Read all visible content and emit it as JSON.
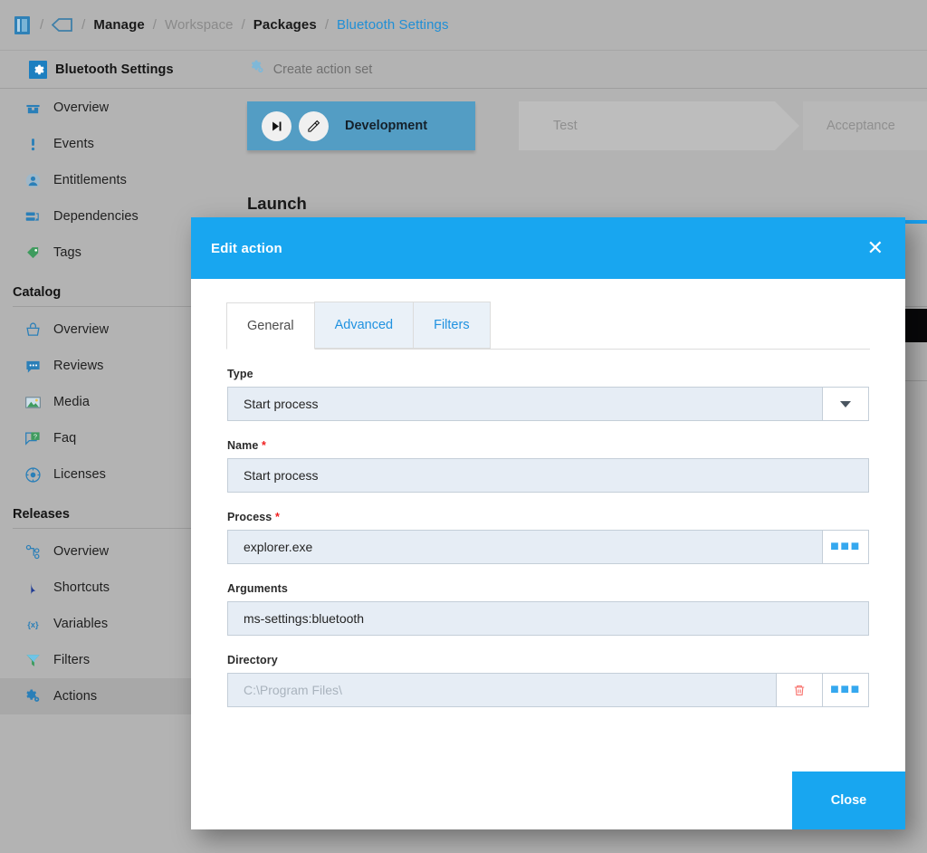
{
  "breadcrumb": {
    "library_icon": "book-icon",
    "tag_icon": "tag-icon",
    "separator": "/",
    "items": [
      {
        "label": "Manage",
        "style": "dark"
      },
      {
        "label": "Workspace",
        "style": "mute"
      },
      {
        "label": "Packages",
        "style": "dark"
      },
      {
        "label": "Bluetooth Settings",
        "style": "blue"
      }
    ]
  },
  "appbar": {
    "icon": "gear-icon",
    "title": "Bluetooth Settings",
    "action_icon": "action-set-icon",
    "action_label": "Create action set"
  },
  "sidebar": {
    "top_items": [
      {
        "label": "Overview",
        "icon": "package-icon"
      },
      {
        "label": "Events",
        "icon": "exclamation-icon"
      },
      {
        "label": "Entitlements",
        "icon": "user-icon"
      },
      {
        "label": "Dependencies",
        "icon": "dependencies-icon"
      },
      {
        "label": "Tags",
        "icon": "tag-icon"
      }
    ],
    "groups": [
      {
        "title": "Catalog",
        "items": [
          {
            "label": "Overview",
            "icon": "basket-icon"
          },
          {
            "label": "Reviews",
            "icon": "comment-icon"
          },
          {
            "label": "Media",
            "icon": "image-icon"
          },
          {
            "label": "Faq",
            "icon": "faq-icon"
          },
          {
            "label": "Licenses",
            "icon": "license-icon"
          }
        ]
      },
      {
        "title": "Releases",
        "items": [
          {
            "label": "Overview",
            "icon": "sitemap-icon"
          },
          {
            "label": "Shortcuts",
            "icon": "shortcut-icon"
          },
          {
            "label": "Variables",
            "icon": "variables-icon"
          },
          {
            "label": "Filters",
            "icon": "funnel-icon"
          },
          {
            "label": "Actions",
            "icon": "actions-gear-icon",
            "active": true
          }
        ]
      }
    ]
  },
  "stages": [
    {
      "label": "Development",
      "state": "active",
      "play_icon": "play-to-end-icon",
      "edit_icon": "pencil-icon"
    },
    {
      "label": "Test",
      "state": "inactive"
    },
    {
      "label": "Acceptance",
      "state": "inactive"
    }
  ],
  "section": {
    "title": "Launch"
  },
  "modal": {
    "title": "Edit action",
    "close_icon": "close-icon",
    "tabs": [
      {
        "label": "General",
        "active": true
      },
      {
        "label": "Advanced",
        "active": false
      },
      {
        "label": "Filters",
        "active": false
      }
    ],
    "fields": {
      "type": {
        "label": "Type",
        "value": "Start process",
        "required": false,
        "adornment": "chevron-down-icon"
      },
      "name": {
        "label": "Name",
        "required_marker": "*",
        "value": "Start process",
        "required": true
      },
      "process": {
        "label": "Process",
        "required_marker": "*",
        "value": "explorer.exe",
        "required": true,
        "adornment": "ellipsis-icon"
      },
      "arguments": {
        "label": "Arguments",
        "value": "ms-settings:bluetooth",
        "required": false
      },
      "directory": {
        "label": "Directory",
        "value": "",
        "placeholder": "C:\\Program Files\\",
        "required": false,
        "adornment_delete": "trash-icon",
        "adornment_browse": "ellipsis-icon"
      }
    },
    "close_button": "Close"
  },
  "colors": {
    "accent_blue": "#18a6f0",
    "link_blue": "#2092e0",
    "stage_active": "#539dc4",
    "page_bg": "#b3b3b3",
    "field_bg": "#e6edf5",
    "required_red": "#ef2020"
  }
}
